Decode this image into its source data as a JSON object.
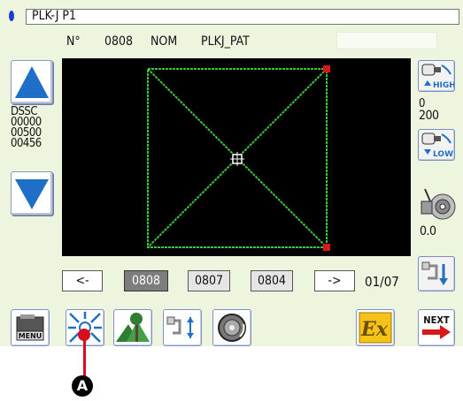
{
  "title": "PLK-J P1",
  "header": {
    "number_label": "N°",
    "number_value": "0808",
    "name_label": "NOM",
    "name_value": "PLKJ_PAT"
  },
  "left_readout": {
    "label": "DSSC",
    "values": [
      "00000",
      "00500",
      "00456"
    ]
  },
  "right_readout": {
    "high_label": "HIGH",
    "low_label": "LOW",
    "value_top": "0",
    "value_bottom": "200",
    "tension_value": "0.0"
  },
  "nav": {
    "prev_label": "<-",
    "next_label": "->",
    "patterns": [
      "0808",
      "0807",
      "0804"
    ],
    "page": "01/07"
  },
  "bottom": {
    "menu_label": "MENU",
    "ex_label": "Ex",
    "next_label": "NEXT"
  },
  "annotation": {
    "marker": "A"
  },
  "colors": {
    "panel_bg": "#eef5df",
    "canvas_bg": "#000000",
    "pattern_line": "#3cc43c",
    "corner_marker": "#d81818",
    "arrow_blue": "#1f6fc8",
    "annotation_red": "#d60d1c"
  }
}
